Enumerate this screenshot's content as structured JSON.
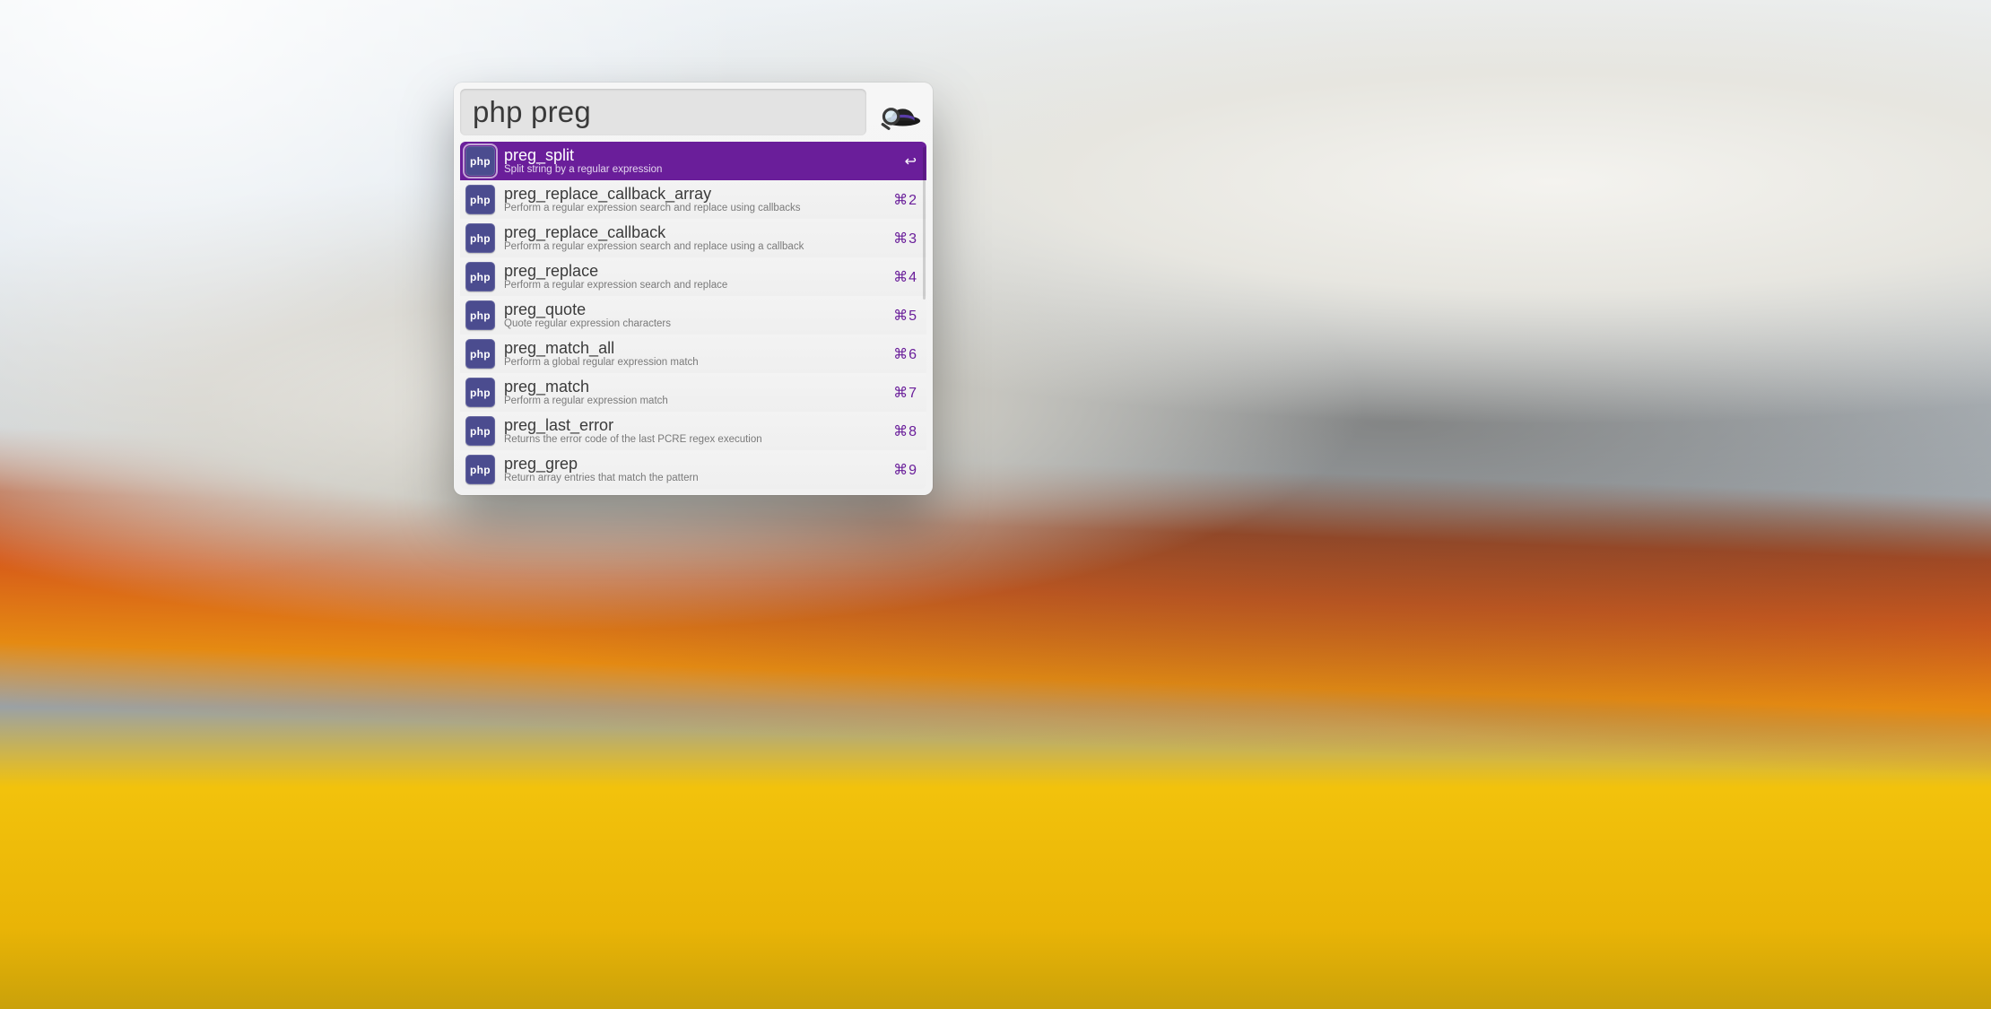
{
  "search": {
    "value": "php preg",
    "placeholder": ""
  },
  "icon_label": "php",
  "selected_index": 0,
  "results": [
    {
      "title": "preg_split",
      "subtitle": "Split string by a regular expression",
      "shortcut": "↩"
    },
    {
      "title": "preg_replace_callback_array",
      "subtitle": "Perform a regular expression search and replace using callbacks",
      "shortcut": "⌘2"
    },
    {
      "title": "preg_replace_callback",
      "subtitle": "Perform a regular expression search and replace using a callback",
      "shortcut": "⌘3"
    },
    {
      "title": "preg_replace",
      "subtitle": "Perform a regular expression search and replace",
      "shortcut": "⌘4"
    },
    {
      "title": "preg_quote",
      "subtitle": "Quote regular expression characters",
      "shortcut": "⌘5"
    },
    {
      "title": "preg_match_all",
      "subtitle": "Perform a global regular expression match",
      "shortcut": "⌘6"
    },
    {
      "title": "preg_match",
      "subtitle": "Perform a regular expression match",
      "shortcut": "⌘7"
    },
    {
      "title": "preg_last_error",
      "subtitle": "Returns the error code of the last PCRE regex execution",
      "shortcut": "⌘8"
    },
    {
      "title": "preg_grep",
      "subtitle": "Return array entries that match the pattern",
      "shortcut": "⌘9"
    }
  ],
  "colors": {
    "accent": "#6a1e9a",
    "icon_bg": "#4b4c8f"
  }
}
